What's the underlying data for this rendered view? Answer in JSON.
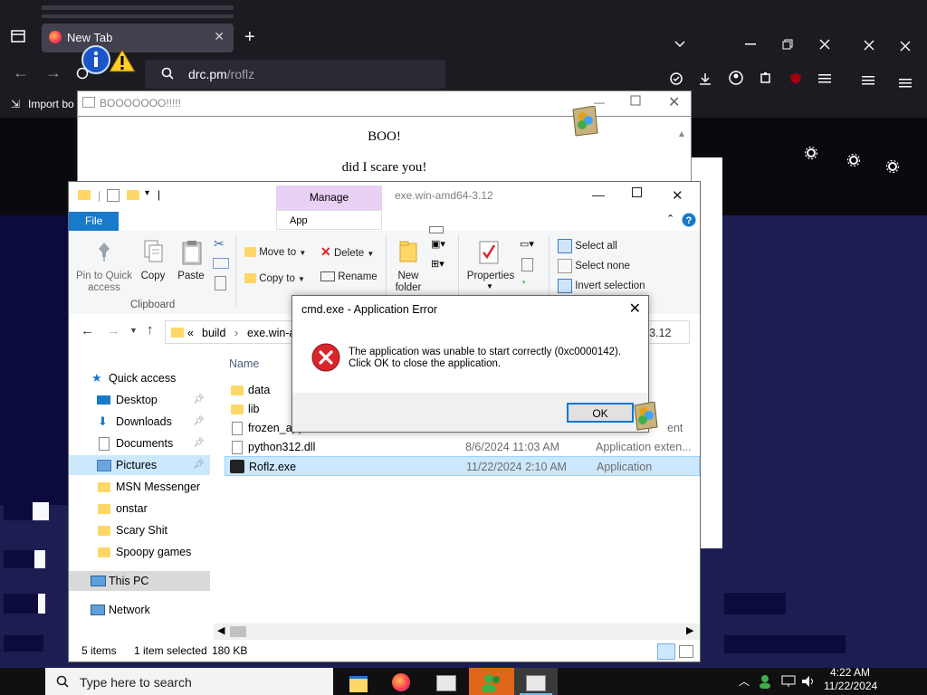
{
  "browser": {
    "tab_title": "New Tab",
    "tab_close": "✕",
    "new_tab": "+",
    "url_host": "drc.pm",
    "url_path": "/roflz",
    "bookmark_label": "Import bo"
  },
  "boo_window": {
    "title": "BOOOOOOO!!!!!",
    "line1": "BOO!",
    "line2": "did I scare you!"
  },
  "explorer": {
    "manage_tab": "Manage",
    "app_tools": "App",
    "title": "exe.win-amd64-3.12",
    "file_tab": "File",
    "ribbon": {
      "pin": [
        "Pin to Quick",
        "access"
      ],
      "copy": "Copy",
      "paste": "Paste",
      "clipboard_group": "Clipboard",
      "move_to": "Move to",
      "copy_to": "Copy to",
      "delete": "Delete",
      "rename": "Rename",
      "new_folder": [
        "New",
        "folder"
      ],
      "properties": "Properties",
      "select_all": "Select all",
      "select_none": "Select none",
      "invert_selection": "Invert selection"
    },
    "address": {
      "prefix": "«",
      "crumb1": "build",
      "crumb2": "exe.win-a",
      "search_hint": "-3.12"
    },
    "nav": {
      "quick_access": "Quick access",
      "items": [
        {
          "label": "Desktop",
          "pinned": true
        },
        {
          "label": "Downloads",
          "pinned": true
        },
        {
          "label": "Documents",
          "pinned": true
        },
        {
          "label": "Pictures",
          "pinned": true
        },
        {
          "label": "MSN Messenger",
          "pinned": false
        },
        {
          "label": "onstar",
          "pinned": false
        },
        {
          "label": "Scary Shit",
          "pinned": false
        },
        {
          "label": "Spoopy games",
          "pinned": false
        }
      ],
      "this_pc": "This PC",
      "network": "Network"
    },
    "files": {
      "column_name": "Name",
      "rows": [
        {
          "name": "data",
          "date": "",
          "type": ""
        },
        {
          "name": "lib",
          "date": "",
          "type": ""
        },
        {
          "name": "frozen_appl",
          "date": "",
          "type": "ent"
        },
        {
          "name": "python312.dll",
          "date": "8/6/2024 11:03 AM",
          "type": "Application exten..."
        },
        {
          "name": "Roflz.exe",
          "date": "11/22/2024 2:10 AM",
          "type": "Application"
        }
      ]
    },
    "status": {
      "count": "5 items",
      "selected": "1 item selected",
      "size": "180 KB"
    }
  },
  "dialog": {
    "title": "cmd.exe - Application Error",
    "close": "✕",
    "message_line1": "The application was unable to start correctly (0xc0000142).",
    "message_line2": "Click OK to close the application.",
    "ok": "OK"
  },
  "taskbar": {
    "search_placeholder": "Type here to search",
    "time": "4:22 AM",
    "date": "11/22/2024"
  },
  "colors": {
    "accent": "#0078d7",
    "manage_tab": "#e8d1f4",
    "file_tab": "#1979ca",
    "selection": "#cce8ff",
    "error_red": "#d9262b",
    "taskbar_active": "#e0661a"
  }
}
